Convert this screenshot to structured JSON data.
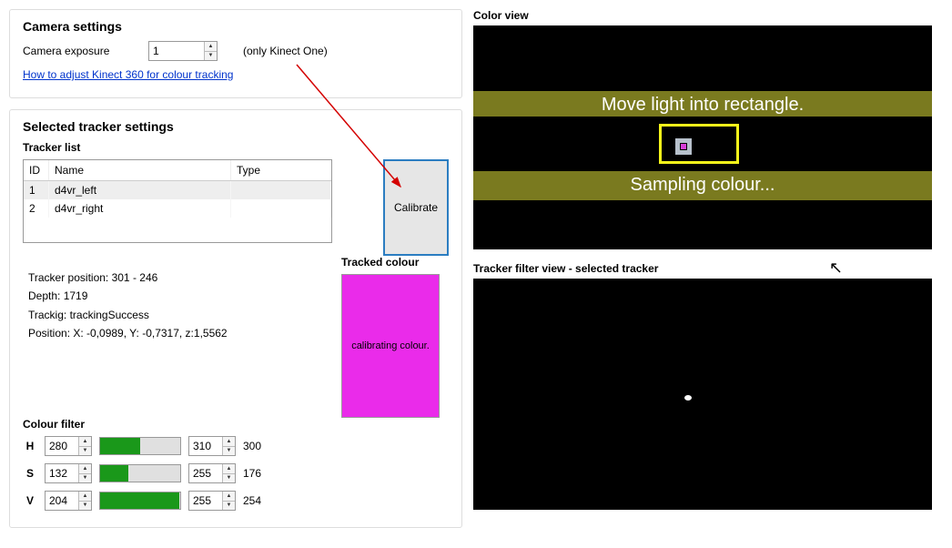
{
  "camera": {
    "title": "Camera settings",
    "exposure_label": "Camera exposure",
    "exposure_value": "1",
    "note": "(only Kinect One)",
    "help_link": "How to adjust Kinect 360 for colour tracking"
  },
  "tracker_settings": {
    "title": "Selected tracker settings",
    "list_label": "Tracker list",
    "headers": {
      "id": "ID",
      "name": "Name",
      "type": "Type"
    },
    "rows": [
      {
        "id": "1",
        "name": "d4vr_left",
        "type": ""
      },
      {
        "id": "2",
        "name": "d4vr_right",
        "type": ""
      }
    ],
    "calibrate_label": "Calibrate"
  },
  "info": {
    "tracker_position": "Tracker position: 301 - 246",
    "depth": "Depth: 1719",
    "tracking": "Trackig: trackingSuccess",
    "position": "Position: X: -0,0989, Y: -0,7317, z:1,5562"
  },
  "tracked_colour": {
    "label": "Tracked colour",
    "status": "calibrating colour.",
    "hex": "#ea2bea"
  },
  "colour_filter": {
    "title": "Colour filter",
    "h": {
      "label": "H",
      "low": "280",
      "high": "310",
      "value": "300",
      "fill_pct": 50
    },
    "s": {
      "label": "S",
      "low": "132",
      "high": "255",
      "value": "176",
      "fill_pct": 35
    },
    "v": {
      "label": "V",
      "low": "204",
      "high": "255",
      "value": "254",
      "fill_pct": 99
    }
  },
  "views": {
    "color_title": "Color view",
    "move_text": "Move light into rectangle.",
    "sampling_text": "Sampling colour...",
    "filter_title": "Tracker filter view - selected tracker"
  }
}
